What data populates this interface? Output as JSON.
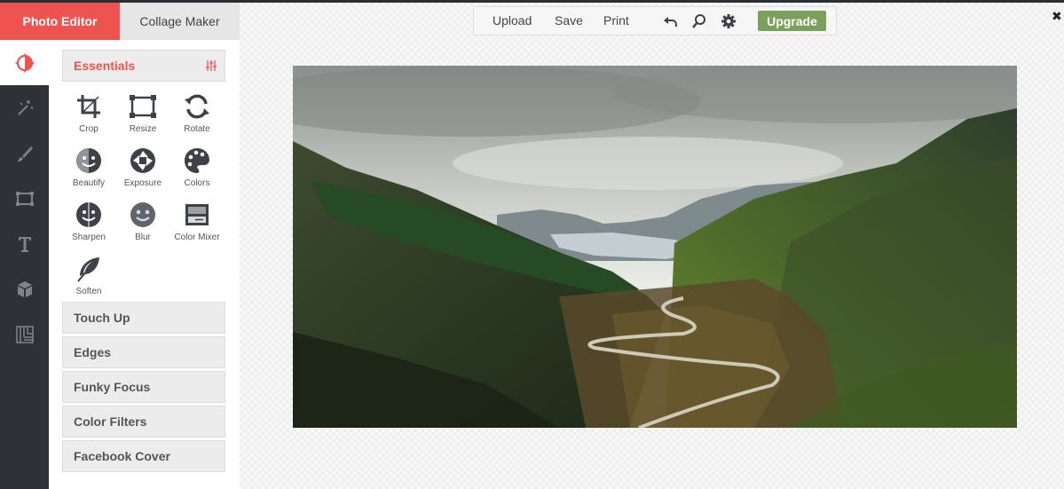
{
  "tabs": {
    "photo_editor": "Photo Editor",
    "collage_maker": "Collage Maker"
  },
  "rail": [
    "essentials-icon",
    "magic-wand-icon",
    "brush-icon",
    "frame-icon",
    "text-icon",
    "sticker-cube-icon",
    "texture-icon"
  ],
  "essentials": {
    "title": "Essentials",
    "tools": [
      {
        "label": "Crop",
        "icon": "crop-icon"
      },
      {
        "label": "Resize",
        "icon": "resize-icon"
      },
      {
        "label": "Rotate",
        "icon": "rotate-icon"
      },
      {
        "label": "Beautify",
        "icon": "beautify-icon"
      },
      {
        "label": "Exposure",
        "icon": "exposure-icon"
      },
      {
        "label": "Colors",
        "icon": "palette-icon"
      },
      {
        "label": "Sharpen",
        "icon": "sharpen-icon"
      },
      {
        "label": "Blur",
        "icon": "blur-icon"
      },
      {
        "label": "Color Mixer",
        "icon": "color-mixer-icon"
      },
      {
        "label": "Soften",
        "icon": "feather-icon"
      }
    ]
  },
  "sections": [
    "Touch Up",
    "Edges",
    "Funky Focus",
    "Color Filters",
    "Facebook Cover"
  ],
  "toolbar": {
    "upload": "Upload",
    "save": "Save",
    "print": "Print",
    "upgrade": "Upgrade",
    "icons": [
      "undo-icon",
      "zoom-icon",
      "settings-gear-icon"
    ]
  },
  "close_glyph": "✖",
  "accent_color": "#ef5350",
  "upgrade_color": "#7ba05b"
}
